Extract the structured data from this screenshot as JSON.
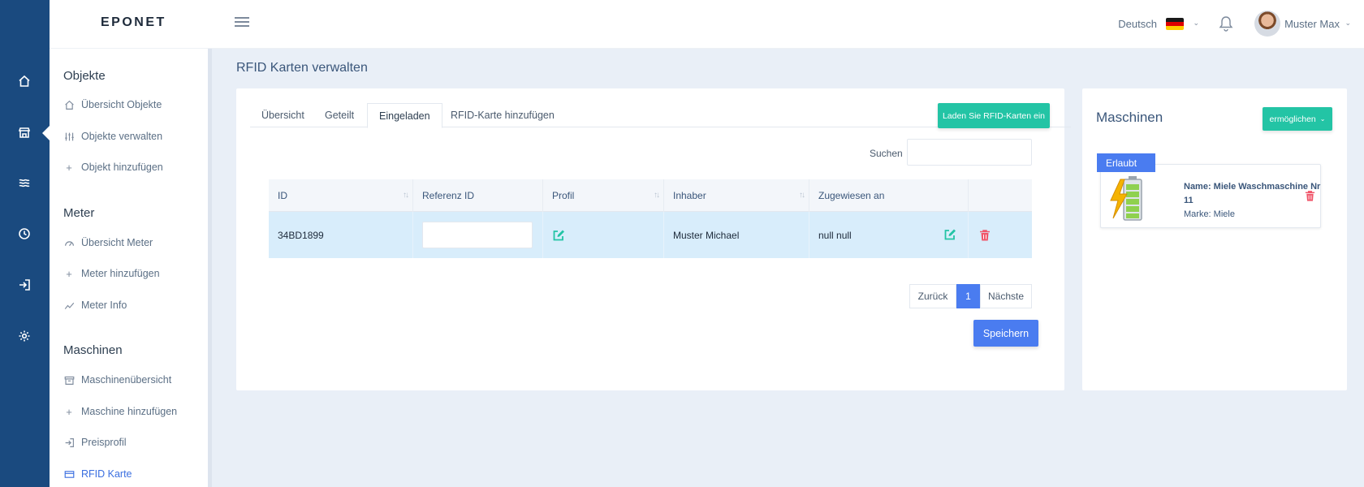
{
  "header": {
    "logo": "EPONET",
    "language": "Deutsch",
    "user_name": "Muster Max"
  },
  "sidebar": {
    "sections": [
      {
        "title": "Objekte",
        "items": [
          {
            "label": "Übersicht Objekte",
            "icon": "home-icon"
          },
          {
            "label": "Objekte verwalten",
            "icon": "sliders-icon"
          },
          {
            "label": "Objekt hinzufügen",
            "icon": "plus-icon"
          }
        ]
      },
      {
        "title": "Meter",
        "items": [
          {
            "label": "Übersicht Meter",
            "icon": "gauge-icon"
          },
          {
            "label": "Meter hinzufügen",
            "icon": "plus-icon"
          },
          {
            "label": "Meter Info",
            "icon": "chart-line-icon"
          }
        ]
      },
      {
        "title": "Maschinen",
        "items": [
          {
            "label": "Maschinenübersicht",
            "icon": "archive-icon"
          },
          {
            "label": "Maschine hinzufügen",
            "icon": "plus-icon"
          },
          {
            "label": "Preisprofil",
            "icon": "login-icon"
          },
          {
            "label": "RFID Karte",
            "icon": "credit-card-icon",
            "active": true
          }
        ]
      }
    ]
  },
  "page": {
    "title": "RFID Karten verwalten"
  },
  "tabs": [
    "Übersicht",
    "Geteilt",
    "Eingeladen",
    "RFID-Karte hinzufügen"
  ],
  "active_tab": "Eingeladen",
  "load_button": "Laden Sie RFID-Karten ein",
  "search": {
    "label": "Suchen",
    "value": "",
    "placeholder": ""
  },
  "table": {
    "columns": [
      "ID",
      "Referenz ID",
      "Profil",
      "Inhaber",
      "Zugewiesen an"
    ],
    "rows": [
      {
        "id": "34BD1899",
        "referenz_id": "",
        "inhaber": "Muster Michael",
        "zugewiesen_an": "null null"
      }
    ]
  },
  "pagination": {
    "prev": "Zurück",
    "current": "1",
    "next": "Nächste"
  },
  "save_button": "Speichern",
  "machines": {
    "title": "Maschinen",
    "enable_button": "ermöglichen",
    "badge": "Erlaubt",
    "item": {
      "name": "Name: Miele Waschmaschine Nr 11",
      "brand": "Marke: Miele"
    }
  },
  "colors": {
    "rail": "#1a4a7f",
    "accent_teal": "#23c4a5",
    "accent_blue": "#4a7cf0",
    "delete_red": "#f0566a"
  }
}
